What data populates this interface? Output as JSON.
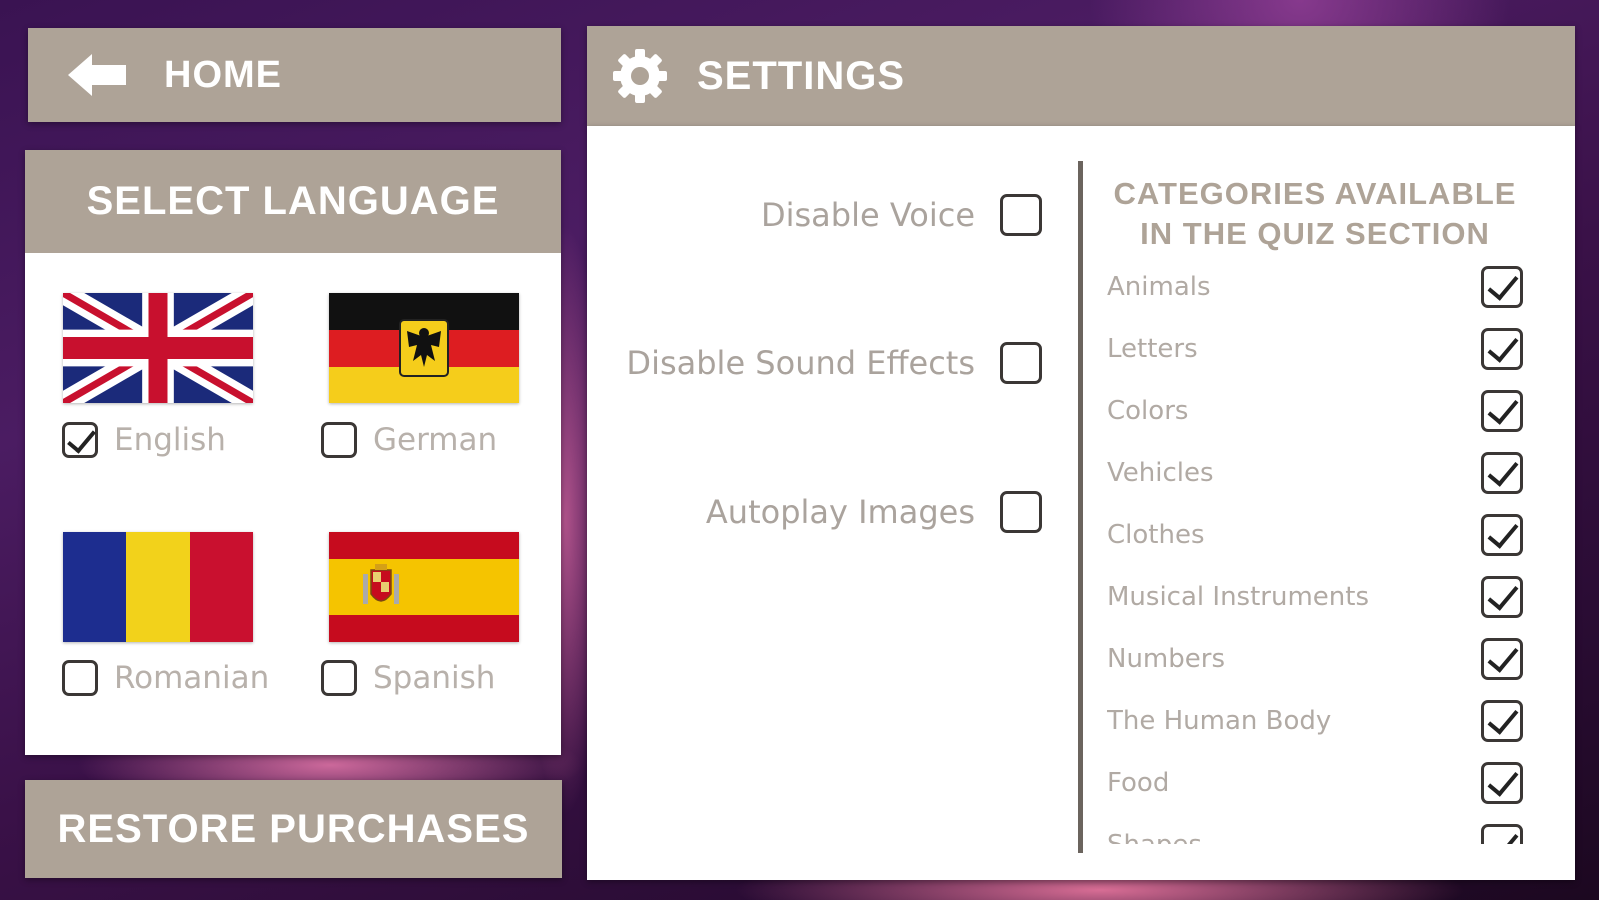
{
  "home": {
    "label": "HOME",
    "icon": "back-arrow-icon"
  },
  "settings": {
    "title": "SETTINGS",
    "icon": "gear-icon"
  },
  "language": {
    "title": "SELECT LANGUAGE",
    "options": [
      {
        "label": "English",
        "checked": true,
        "flag": "uk-flag-icon"
      },
      {
        "label": "German",
        "checked": false,
        "flag": "germany-flag-icon"
      },
      {
        "label": "Romanian",
        "checked": false,
        "flag": "romania-flag-icon"
      },
      {
        "label": "Spanish",
        "checked": false,
        "flag": "spain-flag-icon"
      }
    ]
  },
  "restore": {
    "label": "RESTORE PURCHASES"
  },
  "options": [
    {
      "label": "Disable Voice",
      "checked": false
    },
    {
      "label": "Disable Sound Effects",
      "checked": false
    },
    {
      "label": "Autoplay Images",
      "checked": false
    }
  ],
  "categories": {
    "title_line1": "CATEGORIES AVAILABLE",
    "title_line2": "IN THE QUIZ SECTION",
    "items": [
      {
        "label": "Animals",
        "checked": true
      },
      {
        "label": "Letters",
        "checked": true
      },
      {
        "label": "Colors",
        "checked": true
      },
      {
        "label": "Vehicles",
        "checked": true
      },
      {
        "label": "Clothes",
        "checked": true
      },
      {
        "label": "Musical Instruments",
        "checked": true
      },
      {
        "label": "Numbers",
        "checked": true
      },
      {
        "label": "The Human Body",
        "checked": true
      },
      {
        "label": "Food",
        "checked": true
      },
      {
        "label": "Shapes",
        "checked": true
      }
    ]
  },
  "colors": {
    "bar": "#aea397",
    "accent_text": "#aea397"
  }
}
